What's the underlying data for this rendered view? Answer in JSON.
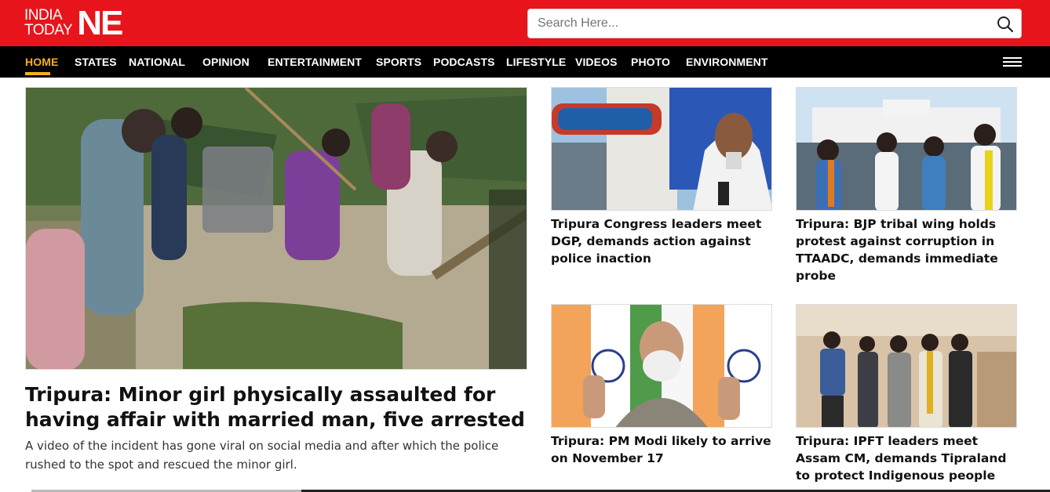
{
  "brand": {
    "logo_line1": "INDIA",
    "logo_line2": "TODAY",
    "logo_ne": "NE",
    "primary_color": "#e8141c",
    "accent_color": "#f6b01e"
  },
  "search": {
    "placeholder": "Search Here...",
    "value": ""
  },
  "nav": {
    "items": [
      {
        "label": "HOME",
        "active": true
      },
      {
        "label": "STATES"
      },
      {
        "label": "NATIONAL"
      },
      {
        "label": "OPINION"
      },
      {
        "label": "ENTERTAINMENT"
      },
      {
        "label": "SPORTS"
      },
      {
        "label": "PODCASTS"
      },
      {
        "label": "LIFESTYLE"
      },
      {
        "label": "VIDEOS"
      },
      {
        "label": "PHOTO"
      },
      {
        "label": "ENVIRONMENT"
      }
    ],
    "menu_icon": "hamburger-icon"
  },
  "main_story": {
    "title": "Tripura: Minor girl physically assaulted for having affair with married man, five arrested",
    "description": "A video of the incident has gone viral on social media and after which the police rushed to the spot and rescued the minor girl."
  },
  "cards": [
    {
      "title": "Tripura Congress leaders meet DGP, demands action against police inaction"
    },
    {
      "title": "Tripura: BJP tribal wing holds protest against corruption in TTAADC, demands immediate probe"
    },
    {
      "title": "Tripura: PM Modi likely to arrive on November 17"
    },
    {
      "title": "Tripura: IPFT leaders meet Assam CM, demands Tipraland to protect Indigenous people"
    }
  ]
}
